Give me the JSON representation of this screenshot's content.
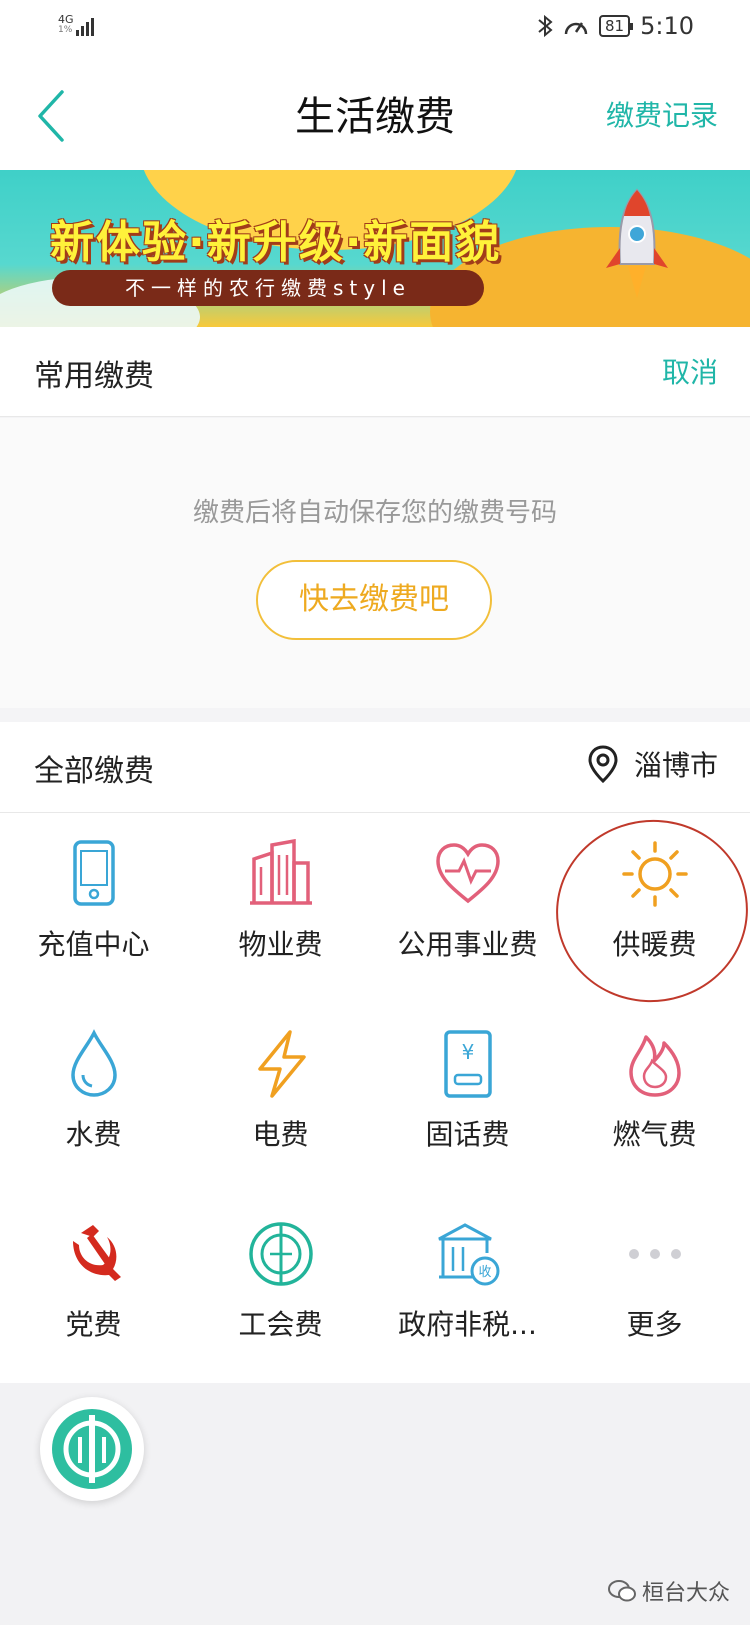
{
  "status_bar": {
    "network": "4G",
    "network_sub": "1%",
    "battery": "81",
    "time": "5:10"
  },
  "nav": {
    "title": "生活缴费",
    "record_link": "缴费记录"
  },
  "banner": {
    "headline": "新体验·新升级·新面貌",
    "subline": "不一样的农行缴费style"
  },
  "common": {
    "title": "常用缴费",
    "cancel": "取消",
    "empty_text": "缴费后将自动保存您的缴费号码",
    "pay_now": "快去缴费吧"
  },
  "all": {
    "title": "全部缴费",
    "city": "淄博市"
  },
  "services": [
    {
      "label": "充值中心",
      "icon": "phone-icon"
    },
    {
      "label": "物业费",
      "icon": "building-icon"
    },
    {
      "label": "公用事业费",
      "icon": "heart-pulse-icon"
    },
    {
      "label": "供暖费",
      "icon": "sun-icon"
    },
    {
      "label": "水费",
      "icon": "water-drop-icon"
    },
    {
      "label": "电费",
      "icon": "lightning-icon"
    },
    {
      "label": "固话费",
      "icon": "landline-icon"
    },
    {
      "label": "燃气费",
      "icon": "flame-icon"
    },
    {
      "label": "党费",
      "icon": "hammer-sickle-icon"
    },
    {
      "label": "工会费",
      "icon": "union-emblem-icon"
    },
    {
      "label": "政府非税...",
      "icon": "government-building-icon"
    },
    {
      "label": "更多",
      "icon": "more-dots-icon"
    }
  ],
  "watermark": "桓台大众",
  "colors": {
    "accent_teal": "#20b6a8",
    "button_gold": "#f2bf3a",
    "icon_blue": "#3aa6d6",
    "icon_pink": "#e2607a",
    "icon_orange": "#f0a020",
    "party_red": "#d42a1e",
    "highlight_ring": "#c0392b"
  }
}
